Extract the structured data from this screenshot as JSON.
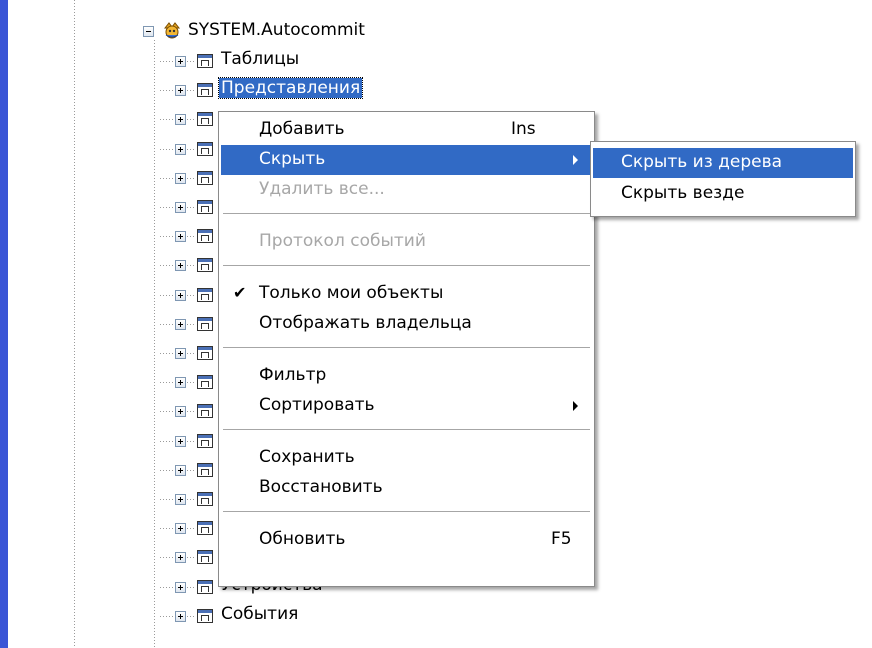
{
  "tree": {
    "root_label": "SYSTEM.Autocommit",
    "nodes": [
      "Таблицы",
      "Представления",
      "",
      "",
      "",
      "",
      "",
      "",
      "",
      "",
      "",
      "",
      "",
      "",
      "",
      "",
      "",
      "",
      "Устройства",
      "События"
    ]
  },
  "context_menu": {
    "items": [
      {
        "label": "Добавить",
        "shortcut": "Ins"
      },
      {
        "label": "Скрыть",
        "has_submenu": true,
        "highlighted": true
      },
      {
        "label": "Удалить все...",
        "disabled": true
      },
      {
        "label": "Протокол событий",
        "disabled": true
      },
      {
        "label": "Только мои объекты",
        "checked": true
      },
      {
        "label": "Отображать владельца"
      },
      {
        "label": "Фильтр"
      },
      {
        "label": "Сортировать",
        "has_submenu": true
      },
      {
        "label": "Сохранить"
      },
      {
        "label": "Восстановить"
      },
      {
        "label": "Обновить",
        "shortcut": "F5"
      }
    ]
  },
  "submenu": {
    "items": [
      {
        "label": "Скрыть из дерева",
        "highlighted": true
      },
      {
        "label": "Скрыть везде"
      }
    ]
  },
  "colors": {
    "selection": "#316ac5",
    "left_bar": "#3a55d6",
    "disabled_text": "#a7a7a7"
  }
}
